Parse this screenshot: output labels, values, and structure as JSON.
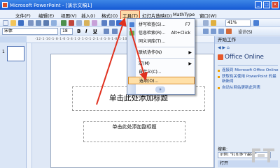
{
  "window": {
    "title": "Microsoft PowerPoint - [演示文稿1]",
    "controls": [
      "_",
      "□",
      "×"
    ]
  },
  "menubar": {
    "items": [
      "文件(F)",
      "编辑(E)",
      "视图(V)",
      "插入(I)",
      "格式(O)",
      "工具(T)",
      "幻灯片放映(D)",
      "MathType",
      "窗口(W)"
    ]
  },
  "toolbar": {
    "font_name": "宋体",
    "font_size": "18",
    "bold": "B",
    "italic": "I",
    "underline": "U",
    "zoom": "41%",
    "design_label": "设计(S)"
  },
  "slides_panel": {
    "slide_number": "1"
  },
  "ruler": {
    "text": "·12·1·10·1·8·1·6·1·4·1·2·1·0·1·2·1·4·1·6·1·8·1·10·1·12·"
  },
  "slide": {
    "title_placeholder": "单击此处添加标题",
    "subtitle_placeholder": "单击此处添加副标题"
  },
  "tools_menu": {
    "items": [
      {
        "label": "拼写检查(S)...",
        "shortcut": "F7",
        "icon_color": "#4a7fd4"
      },
      {
        "label": "信息检索(R)...",
        "shortcut": "Alt+Click",
        "icon_color": "#6aa84f"
      },
      {
        "label": "同义词库(T)...",
        "shortcut": "",
        "icon_color": ""
      },
      {
        "label": "联机协作(N)",
        "shortcut": "",
        "submenu": true,
        "icon_color": ""
      },
      {
        "label": "宏(M)",
        "shortcut": "",
        "submenu": true,
        "icon_color": ""
      },
      {
        "label": "自定义(C)...",
        "shortcut": "",
        "icon_color": ""
      },
      {
        "label": "选项(O)...",
        "shortcut": "",
        "icon_color": ""
      }
    ],
    "highlighted_index": 6,
    "expand_glyph": "»"
  },
  "task_pane": {
    "header": "开始工作",
    "nav": "◀ ▶ ⌂",
    "office_online": "Office Online",
    "links": [
      "连接到 Microsoft Office Online",
      "获取有关使用 PowerPoint 的最新新闻",
      "自动从网站更新此列表"
    ],
    "search_label": "搜索:",
    "search_example": "示例: \"打印多个副本\"",
    "open_label": "打开"
  },
  "colors": {
    "title_gradient_top": "#3d86e6",
    "accent_orange": "#d14a1f",
    "annotation_red": "#e0301e",
    "menu_highlight": "#ffe0a8"
  }
}
